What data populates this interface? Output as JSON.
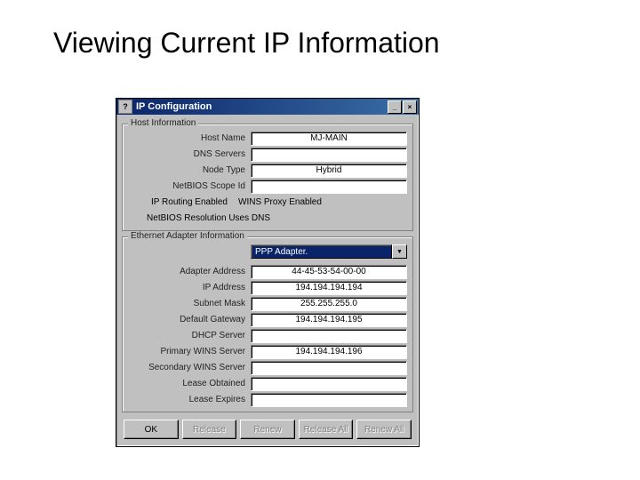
{
  "slide_title": "Viewing Current IP Information",
  "window": {
    "title": "IP Configuration",
    "icon_glyph": "?",
    "minimize": "_",
    "close": "×"
  },
  "host_group": {
    "legend": "Host Information",
    "rows": {
      "host_name": {
        "label": "Host Name",
        "value": "MJ-MAIN"
      },
      "dns_servers": {
        "label": "DNS Servers",
        "value": ""
      },
      "node_type": {
        "label": "Node Type",
        "value": "Hybrid"
      },
      "netbios_scope": {
        "label": "NetBIOS Scope Id",
        "value": ""
      },
      "ip_routing_label": "IP Routing Enabled",
      "wins_proxy_label": "WINS Proxy Enabled",
      "netbios_dns": {
        "label": "NetBIOS Resolution Uses DNS"
      }
    }
  },
  "adapter_group": {
    "legend": "Ethernet Adapter Information",
    "combo_value": "PPP Adapter.",
    "rows": {
      "adapter_address": {
        "label": "Adapter Address",
        "value": "44-45-53-54-00-00"
      },
      "ip_address": {
        "label": "IP Address",
        "value": "194.194.194.194"
      },
      "subnet_mask": {
        "label": "Subnet Mask",
        "value": "255.255.255.0"
      },
      "default_gateway": {
        "label": "Default Gateway",
        "value": "194.194.194.195"
      },
      "dhcp_server": {
        "label": "DHCP Server",
        "value": ""
      },
      "primary_wins": {
        "label": "Primary WINS Server",
        "value": "194.194.194.196"
      },
      "secondary_wins": {
        "label": "Secondary WINS Server",
        "value": ""
      },
      "lease_obtained": {
        "label": "Lease Obtained",
        "value": ""
      },
      "lease_expires": {
        "label": "Lease Expires",
        "value": ""
      }
    }
  },
  "buttons": {
    "ok": "OK",
    "release": "Release",
    "renew": "Renew",
    "release_all": "Release All",
    "renew_all": "Renew All"
  }
}
